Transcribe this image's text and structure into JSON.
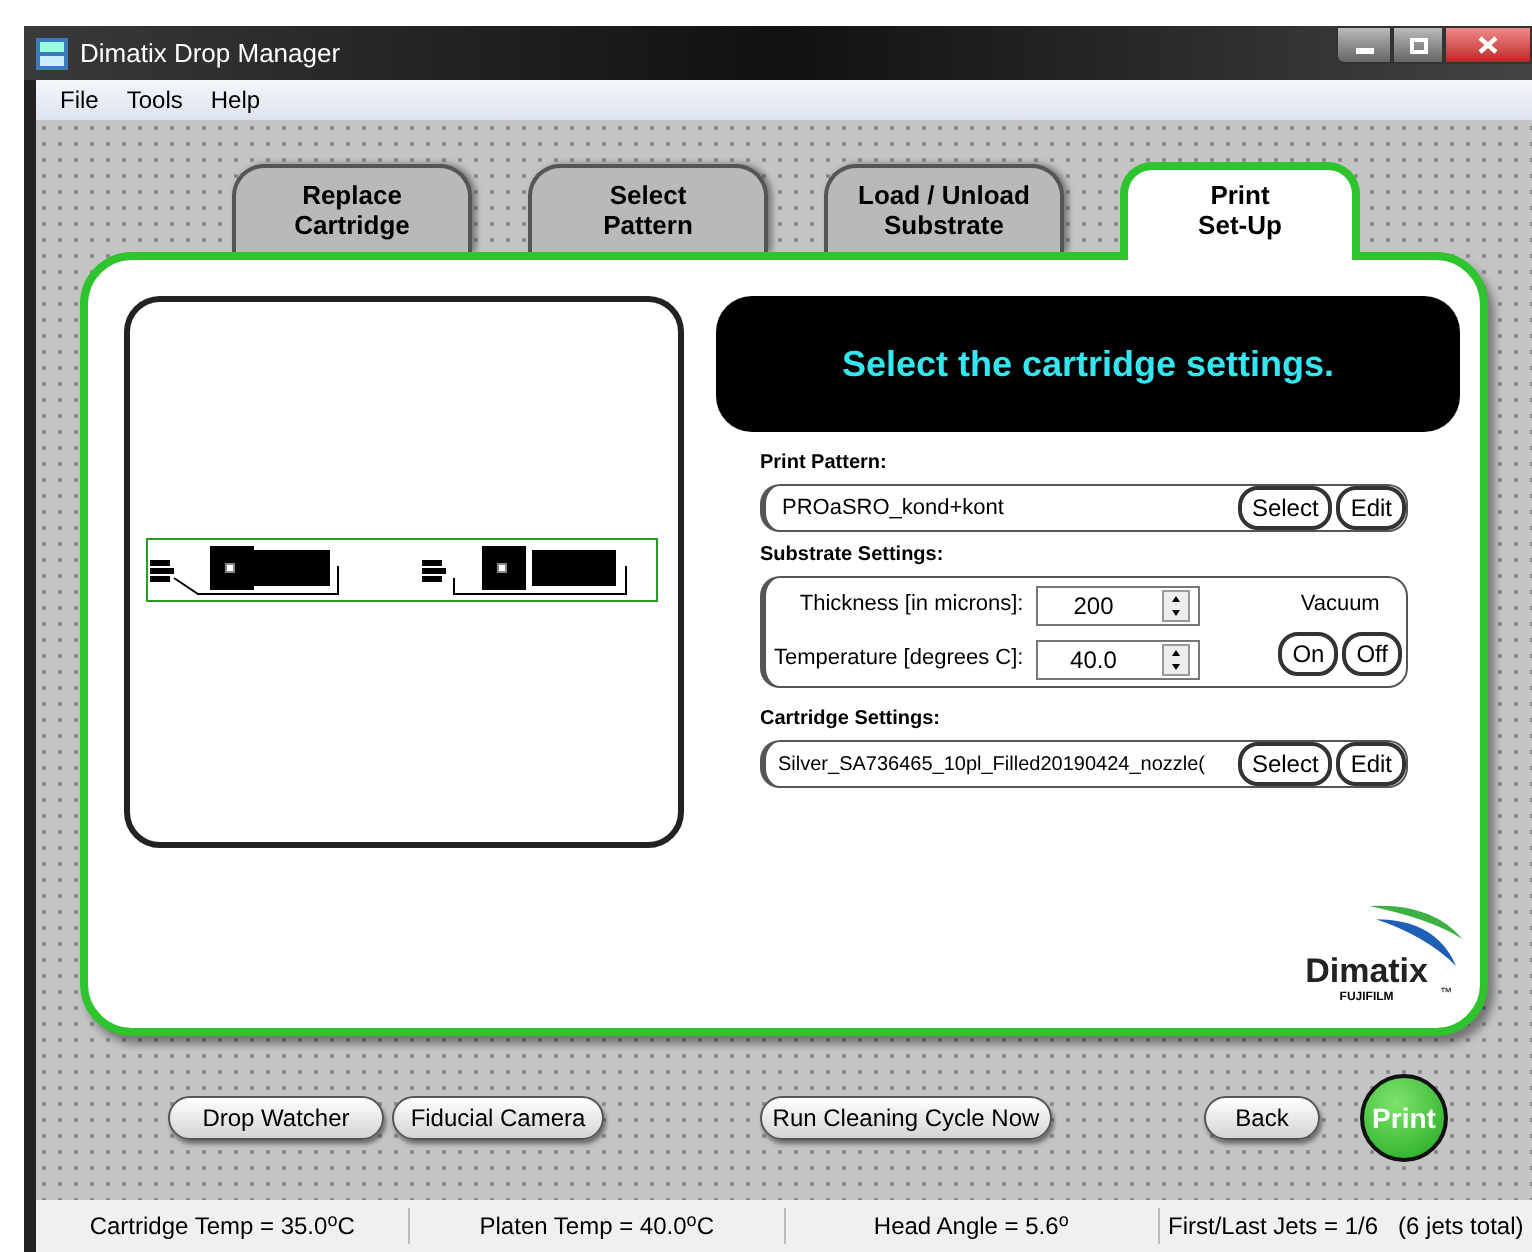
{
  "window": {
    "title": "Dimatix Drop Manager"
  },
  "menu": [
    "File",
    "Tools",
    "Help"
  ],
  "tabs": [
    {
      "label": "Replace\nCartridge",
      "selected": false
    },
    {
      "label": "Select\nPattern",
      "selected": false
    },
    {
      "label": "Load / Unload\nSubstrate",
      "selected": false
    },
    {
      "label": "Print\nSet-Up",
      "selected": true
    }
  ],
  "heading": "Select the cartridge settings.",
  "print_pattern": {
    "label": "Print Pattern:",
    "value": "PROaSRO_kond+kont",
    "buttons": [
      "Select",
      "Edit"
    ]
  },
  "substrate": {
    "label": "Substrate Settings:",
    "thickness_label": "Thickness [in microns]:",
    "thickness": "200",
    "temperature_label": "Temperature [degrees C]:",
    "temperature": "40.0",
    "vacuum_label": "Vacuum",
    "vacuum_buttons": [
      "On",
      "Off"
    ]
  },
  "cartridge": {
    "label": "Cartridge Settings:",
    "value": "Silver_SA736465_10pl_Filled20190424_nozzle(",
    "buttons": [
      "Select",
      "Edit"
    ]
  },
  "logo": {
    "name": "Dimatix",
    "sub": "FUJIFILM",
    "tm": "™"
  },
  "bottom_buttons": [
    "Drop Watcher",
    "Fiducial Camera",
    "Run Cleaning Cycle Now",
    "Back"
  ],
  "print_button": "Print",
  "status_bar": [
    "Cartridge Temp = 35.0$^{o}$C",
    "Platen Temp = 40.0$^{o}$C",
    "Head Angle = 5.6$^{o}$",
    "First/Last Jets = 1/6   (6 jets total)"
  ]
}
